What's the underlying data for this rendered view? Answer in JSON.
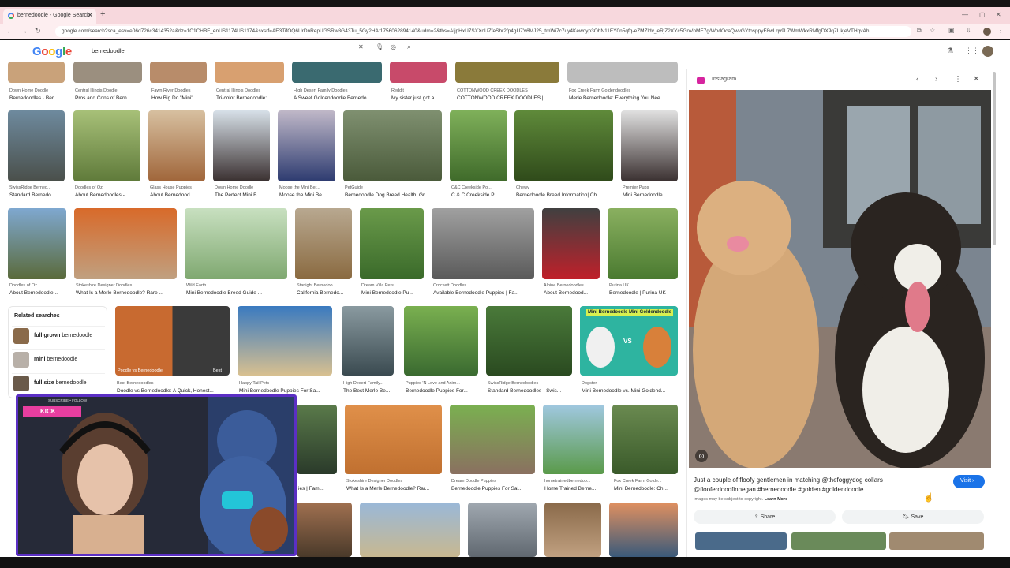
{
  "browser": {
    "tab_title": "bernedoodle - Google Search",
    "url": "google.com/search?sca_esv=e06d726c3414352a&rlz=1C1CHBF_enUS1174US1174&sxsrf=AE3TifOQ6UrDnRepUGSRw8G43Tu_5Gy2HA:1756062894140&udm=2&tbs=AIjpHxU7SXXnUZfeShr2fp4gU7Y6MJ25_tmWi7c7uy4Kewoyp3OhN11EY0n5qfq-eZMZldv_eRjZ2XYc5GnVnME7g/WodOcaQwvGYtosppyF8wLqv9L7WmWkxRMfgDX9q7UkjeVTHqvAhI...",
    "accent_color": "#f7d8dd"
  },
  "search": {
    "logo": "Google",
    "query": "bernedoodle"
  },
  "grid": {
    "row0": [
      {
        "src": "Down Home Doodle",
        "title": "Bernedoodles · Ber..."
      },
      {
        "src": "Central Illinois Doodle",
        "title": "Pros and Cons of Bern..."
      },
      {
        "src": "Fawn River Doodles",
        "title": "How Big Do \"Mini\"..."
      },
      {
        "src": "Central Illinois Doodles",
        "title": "Tri-color Bernedoodle:..."
      },
      {
        "src": "High Desert Family Doodles",
        "title": "A Sweet Goldendoodle Bernedo..."
      },
      {
        "src": "Reddit",
        "title": "My sister just got a..."
      },
      {
        "src": "COTTONWOOD CREEK DOODLES",
        "title": "COTTONWOOD CREEK DOODLES | ..."
      },
      {
        "src": "Fox Creek Farm Goldendoodles",
        "title": "Merle Bernedoodle: Everything You Nee..."
      }
    ],
    "row1": [
      {
        "src": "SwissRidge Berned...",
        "title": "Standard Bernedo..."
      },
      {
        "src": "Doodles of Oz",
        "title": "About Bernedoodles - ..."
      },
      {
        "src": "Glass House Puppies",
        "title": "About Bernedood..."
      },
      {
        "src": "Down Home Doodle",
        "title": "The Perfect Mini B..."
      },
      {
        "src": "Moose the Mini Ber...",
        "title": "Moose the Mini Be..."
      },
      {
        "src": "PetGuide",
        "title": "Bernedoodle Dog Breed Health, Gr..."
      },
      {
        "src": "C&C Creekside Po...",
        "title": "C & C Creekside P..."
      },
      {
        "src": "Chewy",
        "title": "Bernedoodle Breed Information| Ch..."
      },
      {
        "src": "Premier Pups",
        "title": "Mini Bernedoodle ..."
      }
    ],
    "row2": [
      {
        "src": "Doodles of Oz",
        "title": "About Bernedoodle..."
      },
      {
        "src": "Stokeshire Designer Doodles",
        "title": "What Is a Merle Bernedoodle? Rare ..."
      },
      {
        "src": "Wild Earth",
        "title": "Mini Bernedoodle Breed Guide ..."
      },
      {
        "src": "Starlight Bernedoo...",
        "title": "California Bernedo..."
      },
      {
        "src": "Dream Villa Pets",
        "title": "Mini Bernedoodle Pu..."
      },
      {
        "src": "Crockett Doodles",
        "title": "Available Bernedoodle Puppies | Fa..."
      },
      {
        "src": "Alpine Bernedoodles",
        "title": "About Bernedood..."
      },
      {
        "src": "Purina UK",
        "title": "Bernedoodle | Purina UK"
      }
    ],
    "row3": [
      {
        "src": "Best Bernedoodles",
        "title": "Doodle vs Bernedoodle: A Quick, Honest..."
      },
      {
        "src": "Happy Tail Pets",
        "title": "Mini Bernedoodle Puppies For Sa..."
      },
      {
        "src": "High Desert Family...",
        "title": "The Best Merle Be..."
      },
      {
        "src": "Puppies 'N Love and Anim...",
        "title": "Bernedoodle Puppies For..."
      },
      {
        "src": "SwissRidge Bernedoodles",
        "title": "Standard Bernedoodles - Swis..."
      },
      {
        "src": "Dogster",
        "title": "Mini Bernedoodle vs. Mini Goldend..."
      }
    ],
    "row3_overlay": {
      "left": "Poodle vs Bernedoodle",
      "right": "Best",
      "card_top": "Mini Bernedoodle",
      "card_right": "Mini Goldendoodle",
      "card_vs": "VS"
    },
    "row4": [
      {
        "src": "",
        "title": "ies | Fami..."
      },
      {
        "src": "Stokeshire Designer Doodles",
        "title": "What Is a Merle Bernedoodle? Rar..."
      },
      {
        "src": "Dream Doodle Puppies",
        "title": "Bernedoodle Puppies For Sal..."
      },
      {
        "src": "hometrainedbernedoo...",
        "title": "Home Trained Berne..."
      },
      {
        "src": "Fox Creek Farm Golde...",
        "title": "Mini Bernedoodle: Ch..."
      }
    ]
  },
  "related": {
    "heading": "Related searches",
    "items": [
      {
        "bold": "full grown",
        "rest": "bernedoodle"
      },
      {
        "bold": "mini",
        "rest": "bernedoodle"
      },
      {
        "bold": "full size",
        "rest": "bernedoodle"
      }
    ]
  },
  "panel": {
    "source": "Instagram",
    "caption": "Just a couple of floofy gentlemen in matching @thefoggydog collars @flooferdoodfinnegan #bernedoodle #golden #goldendoodle...",
    "visit": "Visit",
    "copyright": "Images may be subject to copyright.",
    "learn_more": "Learn More",
    "share": "Share",
    "save": "Save"
  },
  "stream": {
    "badge": "KICK",
    "banner": "SUBSCRIBE • FOLLOW"
  }
}
